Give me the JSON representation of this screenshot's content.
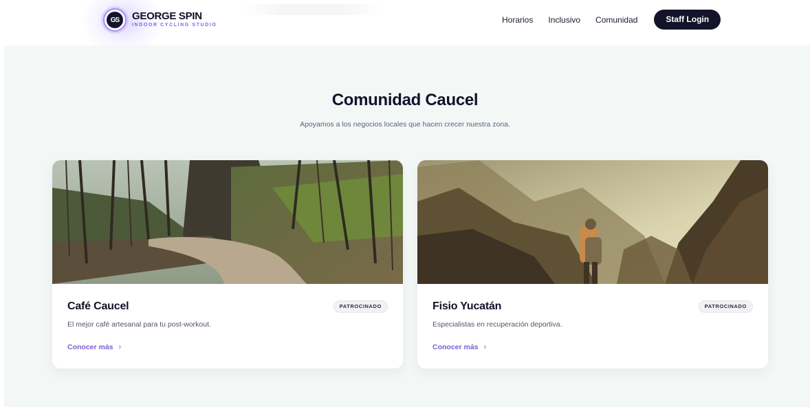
{
  "header": {
    "logo_text": "GS",
    "brand_name": "GEORGE SPIN",
    "brand_tagline": "INDOOR CYCLING STUDIO",
    "nav": [
      {
        "label": "Horarios"
      },
      {
        "label": "Inclusivo"
      },
      {
        "label": "Comunidad"
      }
    ],
    "staff_login": "Staff Login"
  },
  "section": {
    "title": "Comunidad Caucel",
    "subtitle": "Apoyamos a los negocios locales que hacen crecer nuestra zona."
  },
  "cards": [
    {
      "title": "Café Caucel",
      "badge": "PATROCINADO",
      "description": "El mejor café artesanal para tu post-workout.",
      "link": "Conocer más",
      "image": "forest-path-photo"
    },
    {
      "title": "Fisio Yucatán",
      "badge": "PATROCINADO",
      "description": "Especialistas en recuperación deportiva.",
      "link": "Conocer más",
      "image": "mountain-hiker-photo"
    }
  ],
  "colors": {
    "accent": "#7c5cd6",
    "dark": "#13132a",
    "section_bg": "#f3f8f7"
  }
}
